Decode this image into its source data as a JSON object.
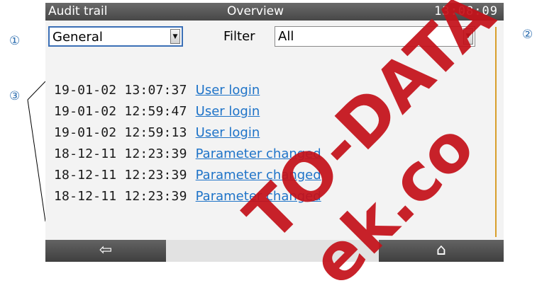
{
  "callouts": {
    "c1": "①",
    "c2": "②",
    "c3": "③"
  },
  "title_bar": {
    "left": "Audit trail",
    "center": "Overview",
    "time": "13:08:09"
  },
  "category_select": {
    "value": "General",
    "arrow": "▼"
  },
  "filter": {
    "label": "Filter",
    "value": "All",
    "arrow": "▼"
  },
  "entries": [
    {
      "timestamp": "19-01-02 13:07:37",
      "event": "User login"
    },
    {
      "timestamp": "19-01-02 12:59:47",
      "event": "User login"
    },
    {
      "timestamp": "19-01-02 12:59:13",
      "event": "User login"
    },
    {
      "timestamp": "18-12-11 12:23:39",
      "event": "Parameter changed"
    },
    {
      "timestamp": "18-12-11 12:23:39",
      "event": "Parameter changed"
    },
    {
      "timestamp": "18-12-11 12:23:39",
      "event": "Parameter changed"
    }
  ],
  "bottom_bar": {
    "back_icon": "⇦",
    "home_icon": "⌂"
  },
  "watermark": {
    "line1": "TO-DATA",
    "line2": "ek.co"
  },
  "colors": {
    "link": "#1e73c8",
    "title_bar": "#474747",
    "watermark": "#c4121a",
    "scroll_accent": "#d89f2c"
  }
}
